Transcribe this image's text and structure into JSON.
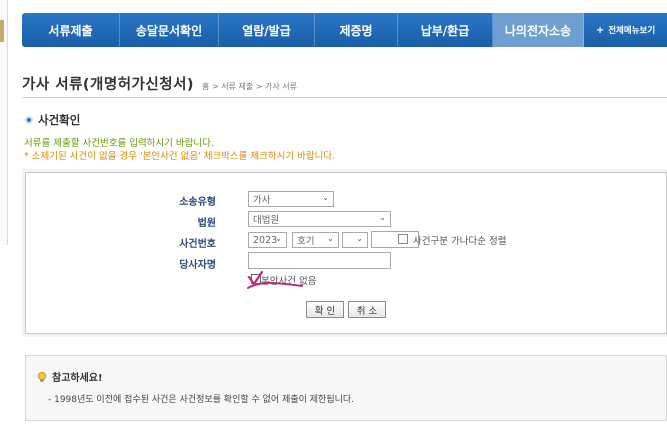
{
  "nav": {
    "items": [
      {
        "label": "서류제출"
      },
      {
        "label": "송달문서확인"
      },
      {
        "label": "열람/발급"
      },
      {
        "label": "제증명"
      },
      {
        "label": "납부/환급"
      },
      {
        "label": "나의전자소송"
      }
    ],
    "active_index": 5,
    "all_menu_label": "전체메뉴보기"
  },
  "page": {
    "title": "가사 서류(개명허가신청서)",
    "breadcrumb": "홈 > 서류 제출 > 가사 서류"
  },
  "section": {
    "title": "사건확인",
    "desc1": "서류를 제출할 사건번호를 입력하시기 바랍니다.",
    "desc2": "* 소제기된 사건이 없을 경우 '본안사건 없음' 체크박스를 체크하시기 바랍니다."
  },
  "form": {
    "case_type_label": "소송유형",
    "case_type_value": "가사",
    "court_label": "법원",
    "court_value": "대법원",
    "case_no_label": "사건번호",
    "year_value": "2023",
    "case_code_value": "호기",
    "case_code_input": "",
    "case_serial_input": "",
    "sort_checkbox_label": "사건구분 가나다순 정렬",
    "sort_checked": false,
    "party_label": "당사자명",
    "party_input": "",
    "no_case_checkbox_label": "본안사건 없음",
    "no_case_checked": true,
    "confirm_label": "확 인",
    "cancel_label": "취 소"
  },
  "notice": {
    "title": "참고하세요!",
    "text": "- 1998년도 이전에 접수된 사건은 사건정보를 확인할 수 없어 제출이 제한됩니다."
  },
  "colors": {
    "nav_bg": "#1a5fa8",
    "nav_active": "#6e9fd0",
    "label_color": "#2d4a7a",
    "desc_green": "#6a9a0a",
    "desc_orange": "#e08a00",
    "annotation_pen": "#c0287a"
  }
}
